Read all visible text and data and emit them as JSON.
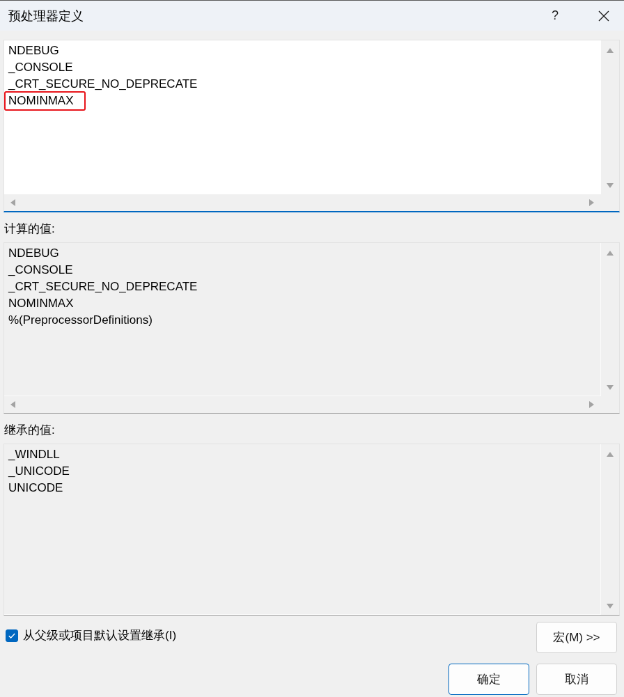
{
  "window": {
    "title": "预处理器定义",
    "help": "?"
  },
  "panes": [
    {
      "kind": "editor",
      "focused": true,
      "horizontal_scrollbar": true,
      "lines": [
        {
          "text": "NDEBUG",
          "highlighted": false
        },
        {
          "text": "_CONSOLE",
          "highlighted": false
        },
        {
          "text": "_CRT_SECURE_NO_DEPRECATE",
          "highlighted": false
        },
        {
          "text": "NOMINMAX",
          "highlighted": true
        }
      ]
    },
    {
      "kind": "readonly",
      "label": "计算的值:",
      "focused": false,
      "horizontal_scrollbar": true,
      "lines": [
        {
          "text": "NDEBUG",
          "highlighted": false
        },
        {
          "text": "_CONSOLE",
          "highlighted": false
        },
        {
          "text": "_CRT_SECURE_NO_DEPRECATE",
          "highlighted": false
        },
        {
          "text": "NOMINMAX",
          "highlighted": false
        },
        {
          "text": "%(PreprocessorDefinitions)",
          "highlighted": false
        }
      ]
    },
    {
      "kind": "readonly",
      "label": "继承的值:",
      "focused": false,
      "horizontal_scrollbar": false,
      "lines": [
        {
          "text": "_WINDLL",
          "highlighted": false
        },
        {
          "text": "_UNICODE",
          "highlighted": false
        },
        {
          "text": "UNICODE",
          "highlighted": false
        }
      ]
    }
  ],
  "inherit_checkbox": {
    "label": "从父级或项目默认设置继承(I)",
    "checked": true
  },
  "macros_button": {
    "label": "宏(M) >>"
  },
  "buttons": [
    {
      "label": "确定",
      "default": true
    },
    {
      "label": "取消",
      "default": false
    }
  ]
}
